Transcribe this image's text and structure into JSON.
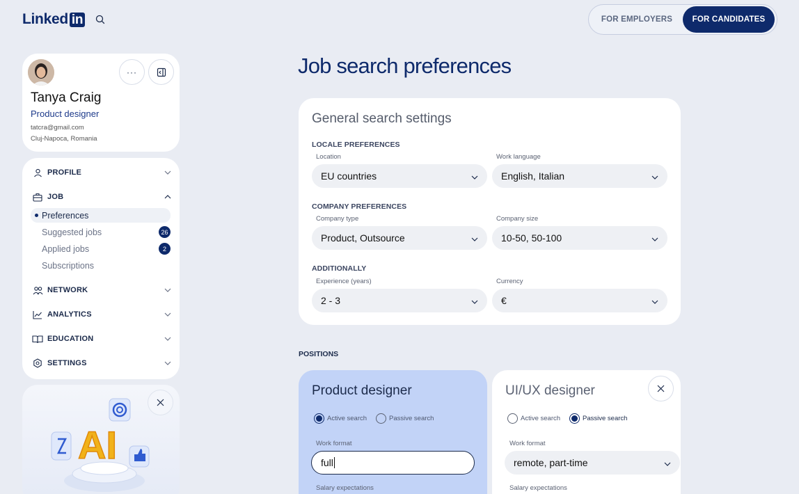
{
  "header": {
    "logo_text": "Linked",
    "logo_badge": "in",
    "switch": [
      "FOR EMPLOYERS",
      "FOR CANDIDATES"
    ]
  },
  "profile": {
    "name": "Tanya Craig",
    "role": "Product designer",
    "email": "tatcra@gmail.com",
    "location": "Cluj-Napoca, Romania",
    "more_glyph": "···"
  },
  "nav": {
    "profile": "PROFILE",
    "job": "JOB",
    "job_items": [
      {
        "label": "Preferences"
      },
      {
        "label": "Suggested jobs",
        "badge": "26"
      },
      {
        "label": "Applied jobs",
        "badge": "2"
      },
      {
        "label": "Subscriptions"
      }
    ],
    "network": "NETWORK",
    "analytics": "ANALYTICS",
    "education": "EDUCATION",
    "settings": "SETTINGS"
  },
  "promo": {
    "art_text": "AI"
  },
  "main": {
    "title": "Job search preferences",
    "general": {
      "title": "General search settings",
      "locale_label": "LOCALE PREFERENCES",
      "location_label": "Location",
      "location_value": "EU countries",
      "work_lang_label": "Work language",
      "work_lang_value": "English, Italian",
      "company_label": "COMPANY PREFERENCES",
      "company_type_label": "Company type",
      "company_type_value": "Product, Outsource",
      "company_size_label": "Company size",
      "company_size_value": "10-50, 50-100",
      "additionally_label": "ADDITIONALLY",
      "experience_label": "Experience (years)",
      "experience_value": "2 - 3",
      "currency_label": "Currency",
      "currency_value": "€"
    },
    "positions_label": "POSITIONS",
    "positions": [
      {
        "title": "Product designer",
        "active_label": "Active search",
        "passive_label": "Passive search",
        "work_format_label": "Work format",
        "work_format_value": "full",
        "salary_label": "Salary expectations"
      },
      {
        "title": "UI/UX designer",
        "active_label": "Active search",
        "passive_label": "Passive search",
        "work_format_label": "Work format",
        "work_format_value": "remote, part-time",
        "salary_label": "Salary expectations"
      }
    ]
  },
  "colors": {
    "brand": "#0e2a6b",
    "highlight_card": "#c2d3f7",
    "background": "#e9ecf3"
  }
}
